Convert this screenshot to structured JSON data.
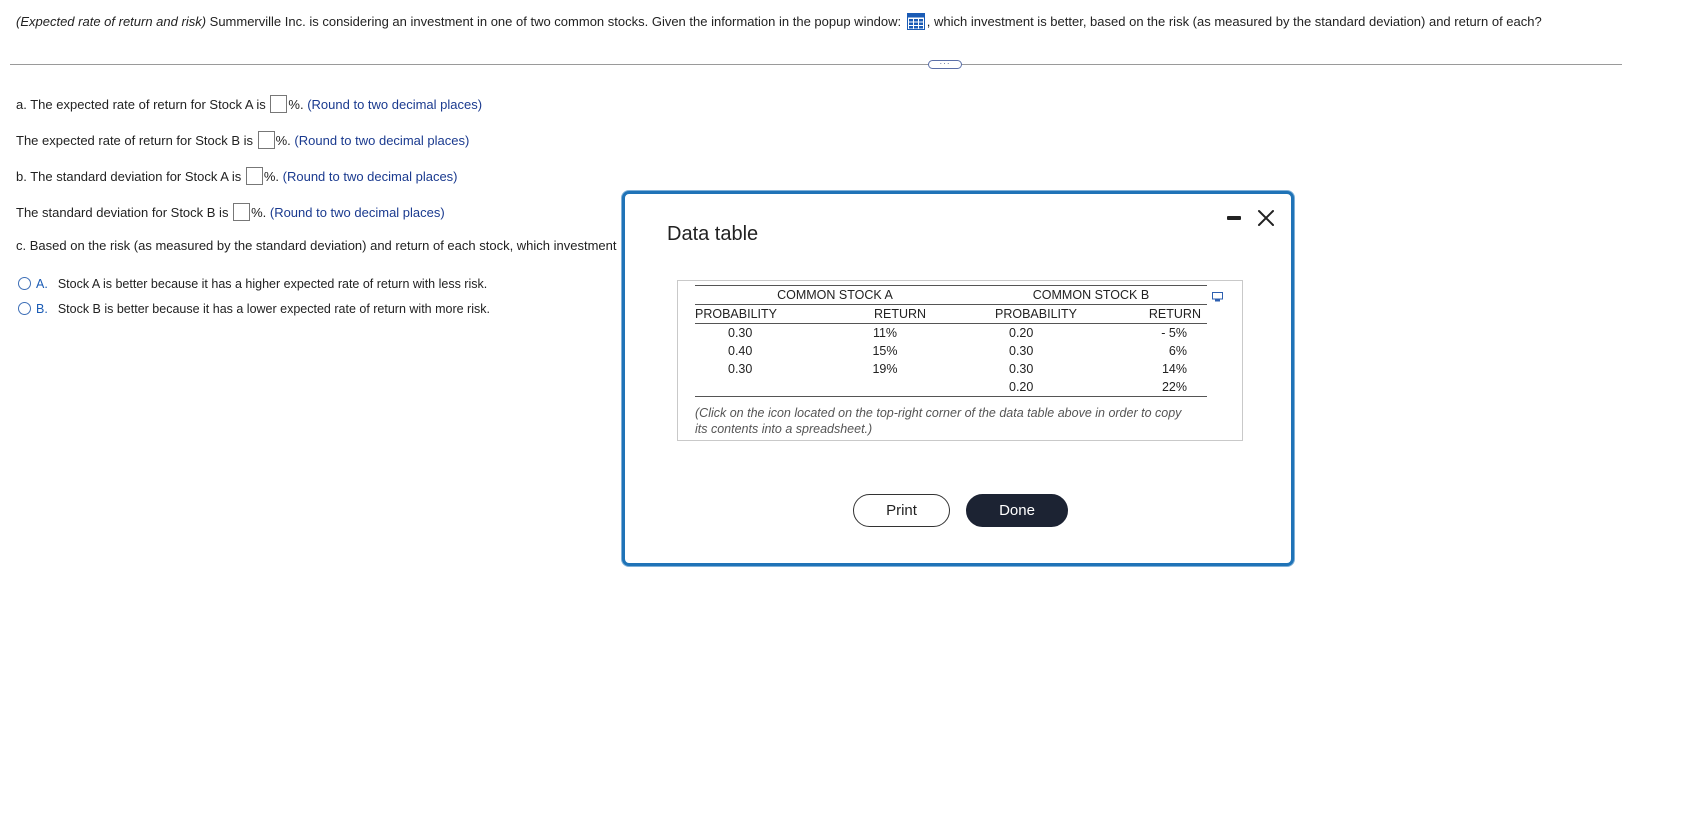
{
  "question": {
    "title_italic": "(Expected rate of return and risk)",
    "text_before_icon": " Summerville Inc. is considering an investment in one of two common stocks. Given the information in the popup window: ",
    "text_after_icon": ", which investment is better, based on the risk (as measured by the standard deviation) and return of each?"
  },
  "expand_label": "···",
  "parts": {
    "a_prefix": "a.",
    "a_text": " The expected rate of return for Stock A is ",
    "a2_text": "The expected rate of return for Stock B is ",
    "b_prefix": "b.",
    "b_text": " The standard deviation for Stock A is ",
    "b2_text": "The standard deviation for Stock B is ",
    "percent": "%.",
    "hint": "(Round to two decimal places)",
    "c_prefix": "c.",
    "c_text": " Based on the risk (as measured by the standard deviation) and return of each stock, which investment"
  },
  "choices": [
    {
      "letter": "A.",
      "text": "Stock A is better because it has a higher expected rate of return with less risk."
    },
    {
      "letter": "B.",
      "text": "Stock B is better because it has a lower expected rate of return with more risk."
    }
  ],
  "modal": {
    "title": "Data table",
    "group_headers": [
      "COMMON STOCK A",
      "COMMON STOCK B"
    ],
    "columns": [
      "PROBABILITY",
      "RETURN",
      "PROBABILITY",
      "RETURN"
    ],
    "rows": [
      [
        "0.30",
        "11%",
        "0.20",
        "- 5%"
      ],
      [
        "0.40",
        "15%",
        "0.30",
        "6%"
      ],
      [
        "0.30",
        "19%",
        "0.30",
        "14%"
      ],
      [
        "",
        "",
        "0.20",
        "22%"
      ]
    ],
    "note": "(Click on the icon located on the top-right corner of the data table above in order to copy its contents into a spreadsheet.)",
    "print_label": "Print",
    "done_label": "Done"
  },
  "colors": {
    "modal_border": "#1f73b7",
    "hint_text": "#1a3a8f",
    "done_button": "#1c2333"
  }
}
